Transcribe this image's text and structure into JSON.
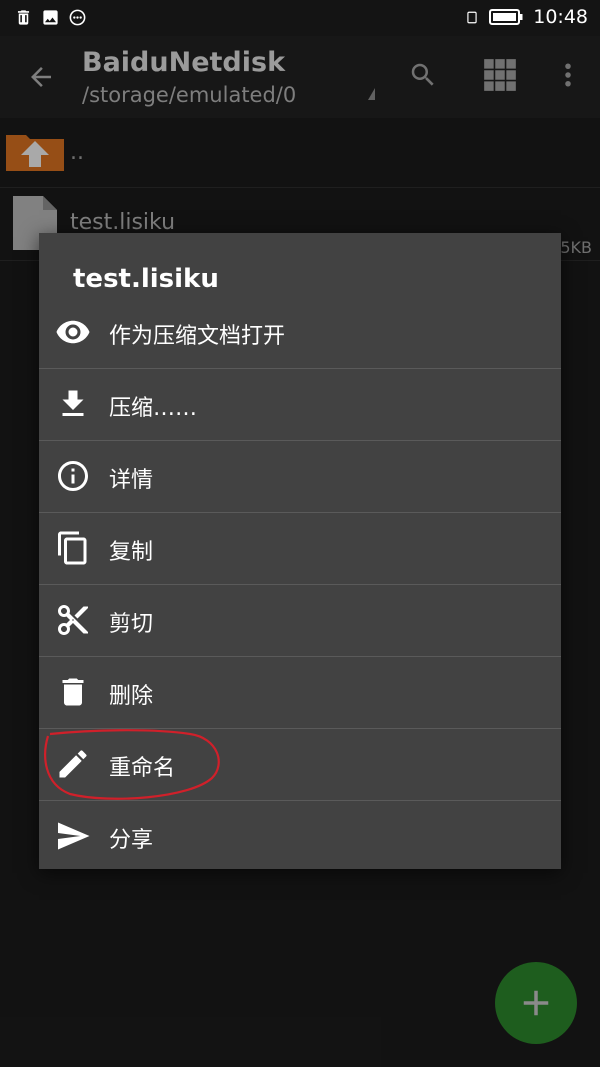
{
  "status_bar": {
    "time": "10:48"
  },
  "toolbar": {
    "title": "BaiduNetdisk",
    "path": "/storage/emulated/0"
  },
  "list": {
    "up_label": "..",
    "file_name": "test.lisiku",
    "file_size": "5KB"
  },
  "dialog": {
    "title": "test.lisiku",
    "items": [
      {
        "label": "作为压缩文档打开",
        "icon": "eye-icon"
      },
      {
        "label": "压缩……",
        "icon": "download-icon"
      },
      {
        "label": "详情",
        "icon": "info-icon"
      },
      {
        "label": "复制",
        "icon": "copy-icon"
      },
      {
        "label": "剪切",
        "icon": "scissors-icon"
      },
      {
        "label": "删除",
        "icon": "trash-icon"
      },
      {
        "label": "重命名",
        "icon": "pencil-icon"
      },
      {
        "label": "分享",
        "icon": "send-icon"
      }
    ]
  },
  "colors": {
    "fab": "#1e5d1e",
    "dialog_bg": "#424242",
    "annotation": "#d0202a"
  }
}
